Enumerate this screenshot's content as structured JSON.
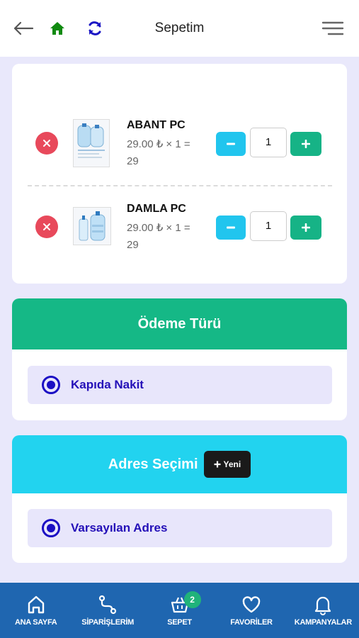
{
  "header": {
    "title": "Sepetim",
    "icons": [
      "back-arrow-icon",
      "home-icon",
      "refresh-icon",
      "menu-icon"
    ]
  },
  "cart": {
    "items": [
      {
        "name": "ABANT PC",
        "price_line1": "29.00 ₺ × 1 =",
        "price_line2": "29",
        "quantity": "1"
      },
      {
        "name": "DAMLA PC",
        "price_line1": "29.00 ₺ × 1 =",
        "price_line2": "29",
        "quantity": "1"
      }
    ]
  },
  "payment": {
    "title": "Ödeme Türü",
    "option": "Kapıda Nakit"
  },
  "address": {
    "title": "Adres Seçimi",
    "new_button": "Yeni",
    "option": "Varsayılan Adres"
  },
  "bottom_nav": {
    "items": [
      {
        "label": "ANA SAYFA",
        "icon": "home-icon"
      },
      {
        "label": "SİPARİŞLERİM",
        "icon": "route-icon"
      },
      {
        "label": "SEPET",
        "icon": "basket-icon",
        "badge": "2"
      },
      {
        "label": "FAVORİLER",
        "icon": "heart-icon"
      },
      {
        "label": "KAMPANYALAR",
        "icon": "bell-icon"
      }
    ]
  },
  "colors": {
    "remove": "#e8495b",
    "minus": "#21c5ee",
    "plus": "#16b386",
    "payment_header": "#15b886",
    "address_header": "#22d3ef",
    "radio": "#1b0fc4",
    "nav_bg": "#1f66b0"
  }
}
